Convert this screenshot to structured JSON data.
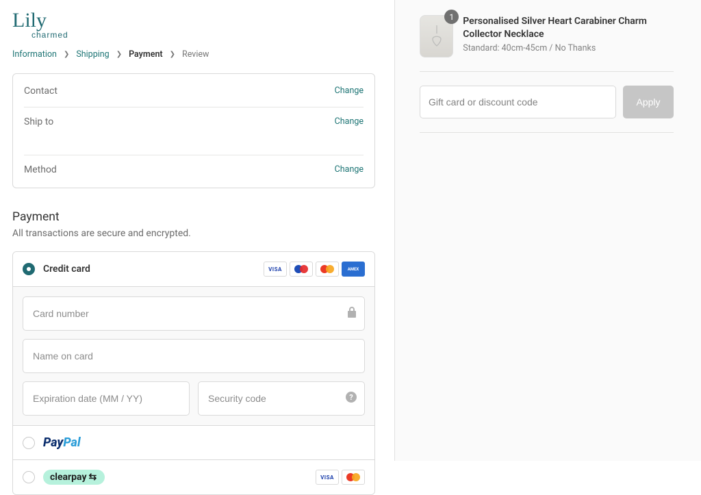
{
  "logo": {
    "line1": "Lily",
    "line2": "charmed"
  },
  "breadcrumb": {
    "information": "Information",
    "shipping": "Shipping",
    "payment": "Payment",
    "review": "Review"
  },
  "review": {
    "contact": {
      "label": "Contact",
      "change": "Change"
    },
    "shipto": {
      "label": "Ship to",
      "change": "Change"
    },
    "method": {
      "label": "Method",
      "change": "Change"
    }
  },
  "payment": {
    "title": "Payment",
    "subtitle": "All transactions are secure and encrypted.",
    "methods": {
      "credit": {
        "label": "Credit card",
        "icons": [
          "visa",
          "maestro",
          "mastercard",
          "amex"
        ]
      },
      "paypal": {
        "label": "PayPal"
      },
      "clearpay": {
        "label": "clearpay",
        "icons": [
          "visa",
          "mastercard"
        ]
      }
    },
    "fields": {
      "card_number": {
        "placeholder": "Card number"
      },
      "name_on_card": {
        "placeholder": "Name on card"
      },
      "expiry": {
        "placeholder": "Expiration date (MM / YY)"
      },
      "cvv": {
        "placeholder": "Security code"
      }
    }
  },
  "order": {
    "product": {
      "title": "Personalised Silver Heart Carabiner Charm Collector Necklace",
      "variant": "Standard: 40cm-45cm / No Thanks",
      "qty": "1"
    },
    "discount": {
      "placeholder": "Gift card or discount code",
      "apply": "Apply"
    }
  }
}
